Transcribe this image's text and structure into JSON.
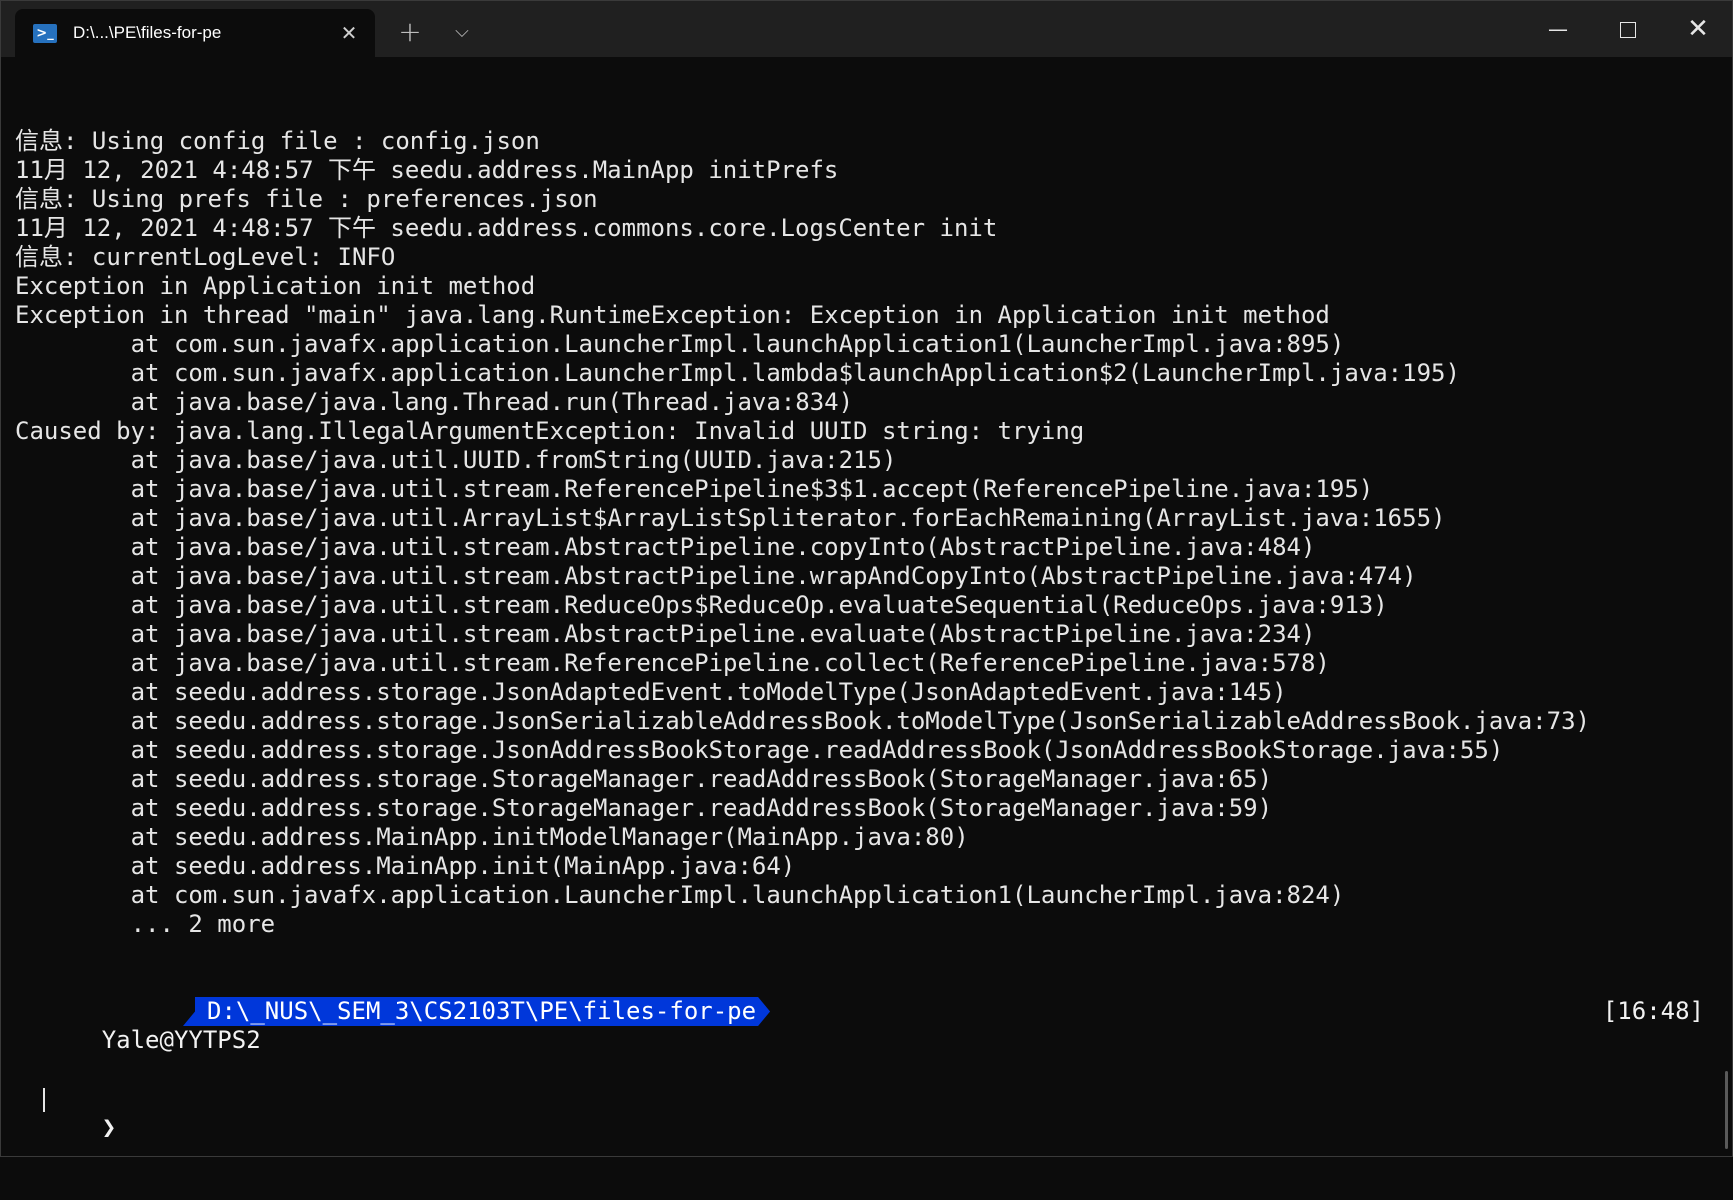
{
  "tab": {
    "title": "D:\\...\\PE\\files-for-pe",
    "icon": "powershell-icon",
    "close_glyph": "✕",
    "new_tab_glyph": "+",
    "dropdown_glyph": "⌵"
  },
  "window_controls": {
    "minimize_glyph": "—",
    "close_glyph": "✕"
  },
  "terminal": {
    "lines": [
      "信息: Using config file : config.json",
      "11月 12, 2021 4:48:57 下午 seedu.address.MainApp initPrefs",
      "信息: Using prefs file : preferences.json",
      "11月 12, 2021 4:48:57 下午 seedu.address.commons.core.LogsCenter init",
      "信息: currentLogLevel: INFO",
      "Exception in Application init method",
      "Exception in thread \"main\" java.lang.RuntimeException: Exception in Application init method",
      "        at com.sun.javafx.application.LauncherImpl.launchApplication1(LauncherImpl.java:895)",
      "        at com.sun.javafx.application.LauncherImpl.lambda$launchApplication$2(LauncherImpl.java:195)",
      "        at java.base/java.lang.Thread.run(Thread.java:834)",
      "Caused by: java.lang.IllegalArgumentException: Invalid UUID string: trying",
      "        at java.base/java.util.UUID.fromString(UUID.java:215)",
      "        at java.base/java.util.stream.ReferencePipeline$3$1.accept(ReferencePipeline.java:195)",
      "        at java.base/java.util.ArrayList$ArrayListSpliterator.forEachRemaining(ArrayList.java:1655)",
      "        at java.base/java.util.stream.AbstractPipeline.copyInto(AbstractPipeline.java:484)",
      "        at java.base/java.util.stream.AbstractPipeline.wrapAndCopyInto(AbstractPipeline.java:474)",
      "        at java.base/java.util.stream.ReduceOps$ReduceOp.evaluateSequential(ReduceOps.java:913)",
      "        at java.base/java.util.stream.AbstractPipeline.evaluate(AbstractPipeline.java:234)",
      "        at java.base/java.util.stream.ReferencePipeline.collect(ReferencePipeline.java:578)",
      "        at seedu.address.storage.JsonAdaptedEvent.toModelType(JsonAdaptedEvent.java:145)",
      "        at seedu.address.storage.JsonSerializableAddressBook.toModelType(JsonSerializableAddressBook.java:73)",
      "        at seedu.address.storage.JsonAddressBookStorage.readAddressBook(JsonAddressBookStorage.java:55)",
      "        at seedu.address.storage.StorageManager.readAddressBook(StorageManager.java:65)",
      "        at seedu.address.storage.StorageManager.readAddressBook(StorageManager.java:59)",
      "        at seedu.address.MainApp.initModelManager(MainApp.java:80)",
      "        at seedu.address.MainApp.init(MainApp.java:64)",
      "        at com.sun.javafx.application.LauncherImpl.launchApplication1(LauncherImpl.java:824)",
      "        ... 2 more"
    ],
    "prompt": {
      "user_host": "Yale@YYTPS2",
      "path": "D:\\_NUS\\_SEM_3\\CS2103T\\PE\\files-for-pe",
      "time": "[16:48]",
      "chevron": "❯"
    }
  },
  "colors": {
    "background": "#0c0c0c",
    "titlebar": "#202020",
    "path_segment": "#0037da",
    "text": "#e6e6e6"
  }
}
